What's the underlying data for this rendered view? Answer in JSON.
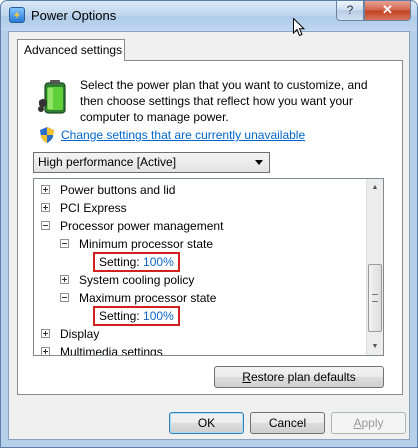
{
  "window": {
    "title": "Power Options",
    "help_label": "?",
    "close_label": "✕"
  },
  "tabs": [
    {
      "label": "Advanced settings"
    }
  ],
  "description": "Select the power plan that you want to customize, and then choose settings that reflect how you want your computer to manage power.",
  "change_link": "Change settings that are currently unavailable",
  "plan_select": {
    "selected": "High performance [Active]"
  },
  "tree": {
    "items": [
      {
        "label": "Power buttons and lid",
        "expanded": false
      },
      {
        "label": "PCI Express",
        "expanded": false
      },
      {
        "label": "Processor power management",
        "expanded": true
      },
      {
        "label": "Minimum processor state",
        "expanded": true
      },
      {
        "setting_label": "Setting:",
        "setting_value": "100%"
      },
      {
        "label": "System cooling policy",
        "expanded": false
      },
      {
        "label": "Maximum processor state",
        "expanded": true
      },
      {
        "setting_label": "Setting:",
        "setting_value": "100%"
      },
      {
        "label": "Display",
        "expanded": false
      },
      {
        "label": "Multimedia settings",
        "expanded": false
      }
    ]
  },
  "buttons": {
    "restore": {
      "prefix": "R",
      "rest": "estore plan defaults"
    },
    "ok": "OK",
    "cancel": "Cancel",
    "apply": {
      "prefix": "A",
      "rest": "pply"
    }
  },
  "colors": {
    "link": "#0066cc",
    "setting_value": "#0b63c8",
    "highlight_box": "#d02020"
  }
}
